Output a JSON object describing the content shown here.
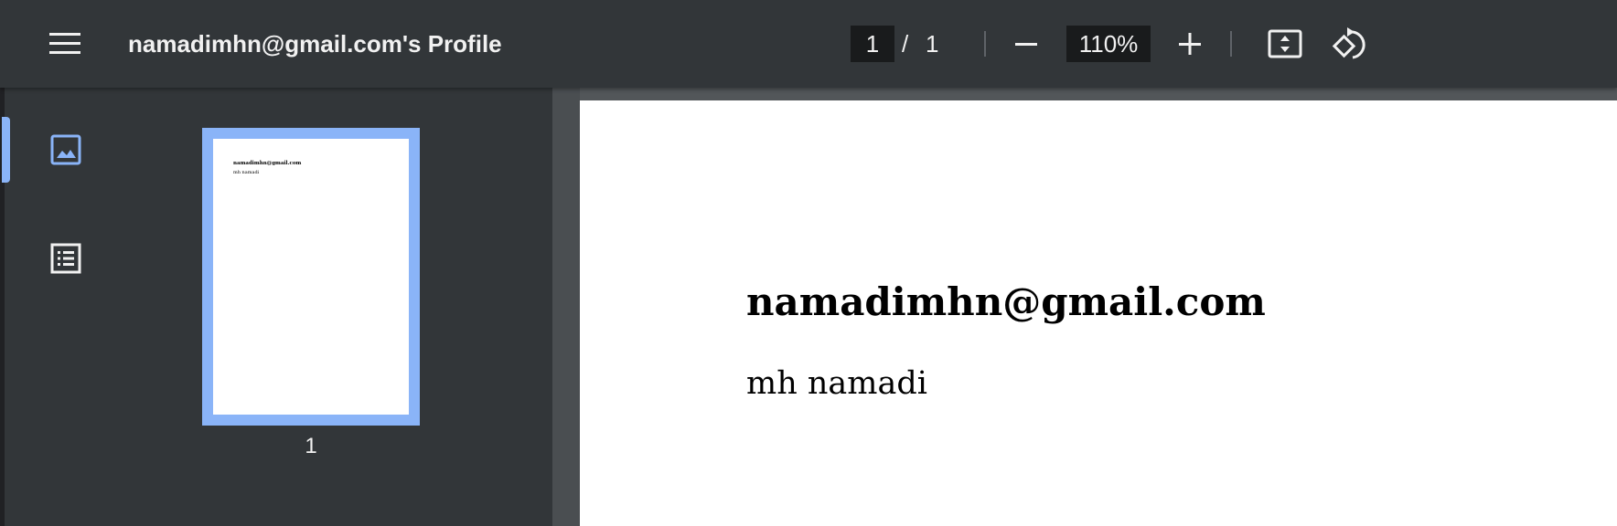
{
  "toolbar": {
    "title": "namadimhn@gmail.com's Profile",
    "page_current": "1",
    "page_separator": "/",
    "page_total": "1",
    "zoom": "110%",
    "icons": [
      "menu-icon",
      "zoom-out-icon",
      "zoom-in-icon",
      "fit-to-page-icon",
      "rotate-icon"
    ]
  },
  "sidebar": {
    "icons": [
      "thumbnails-icon",
      "outline-icon"
    ],
    "thumbnail": {
      "page_number": "1",
      "heading": "namadimhn@gmail.com",
      "subtext": "mh namadi"
    }
  },
  "document": {
    "heading": "namadimhn@gmail.com",
    "subtext": "mh namadi"
  },
  "colors": {
    "toolbar_bg": "#323639",
    "viewer_bg": "#525659",
    "accent": "#8ab4f8"
  }
}
